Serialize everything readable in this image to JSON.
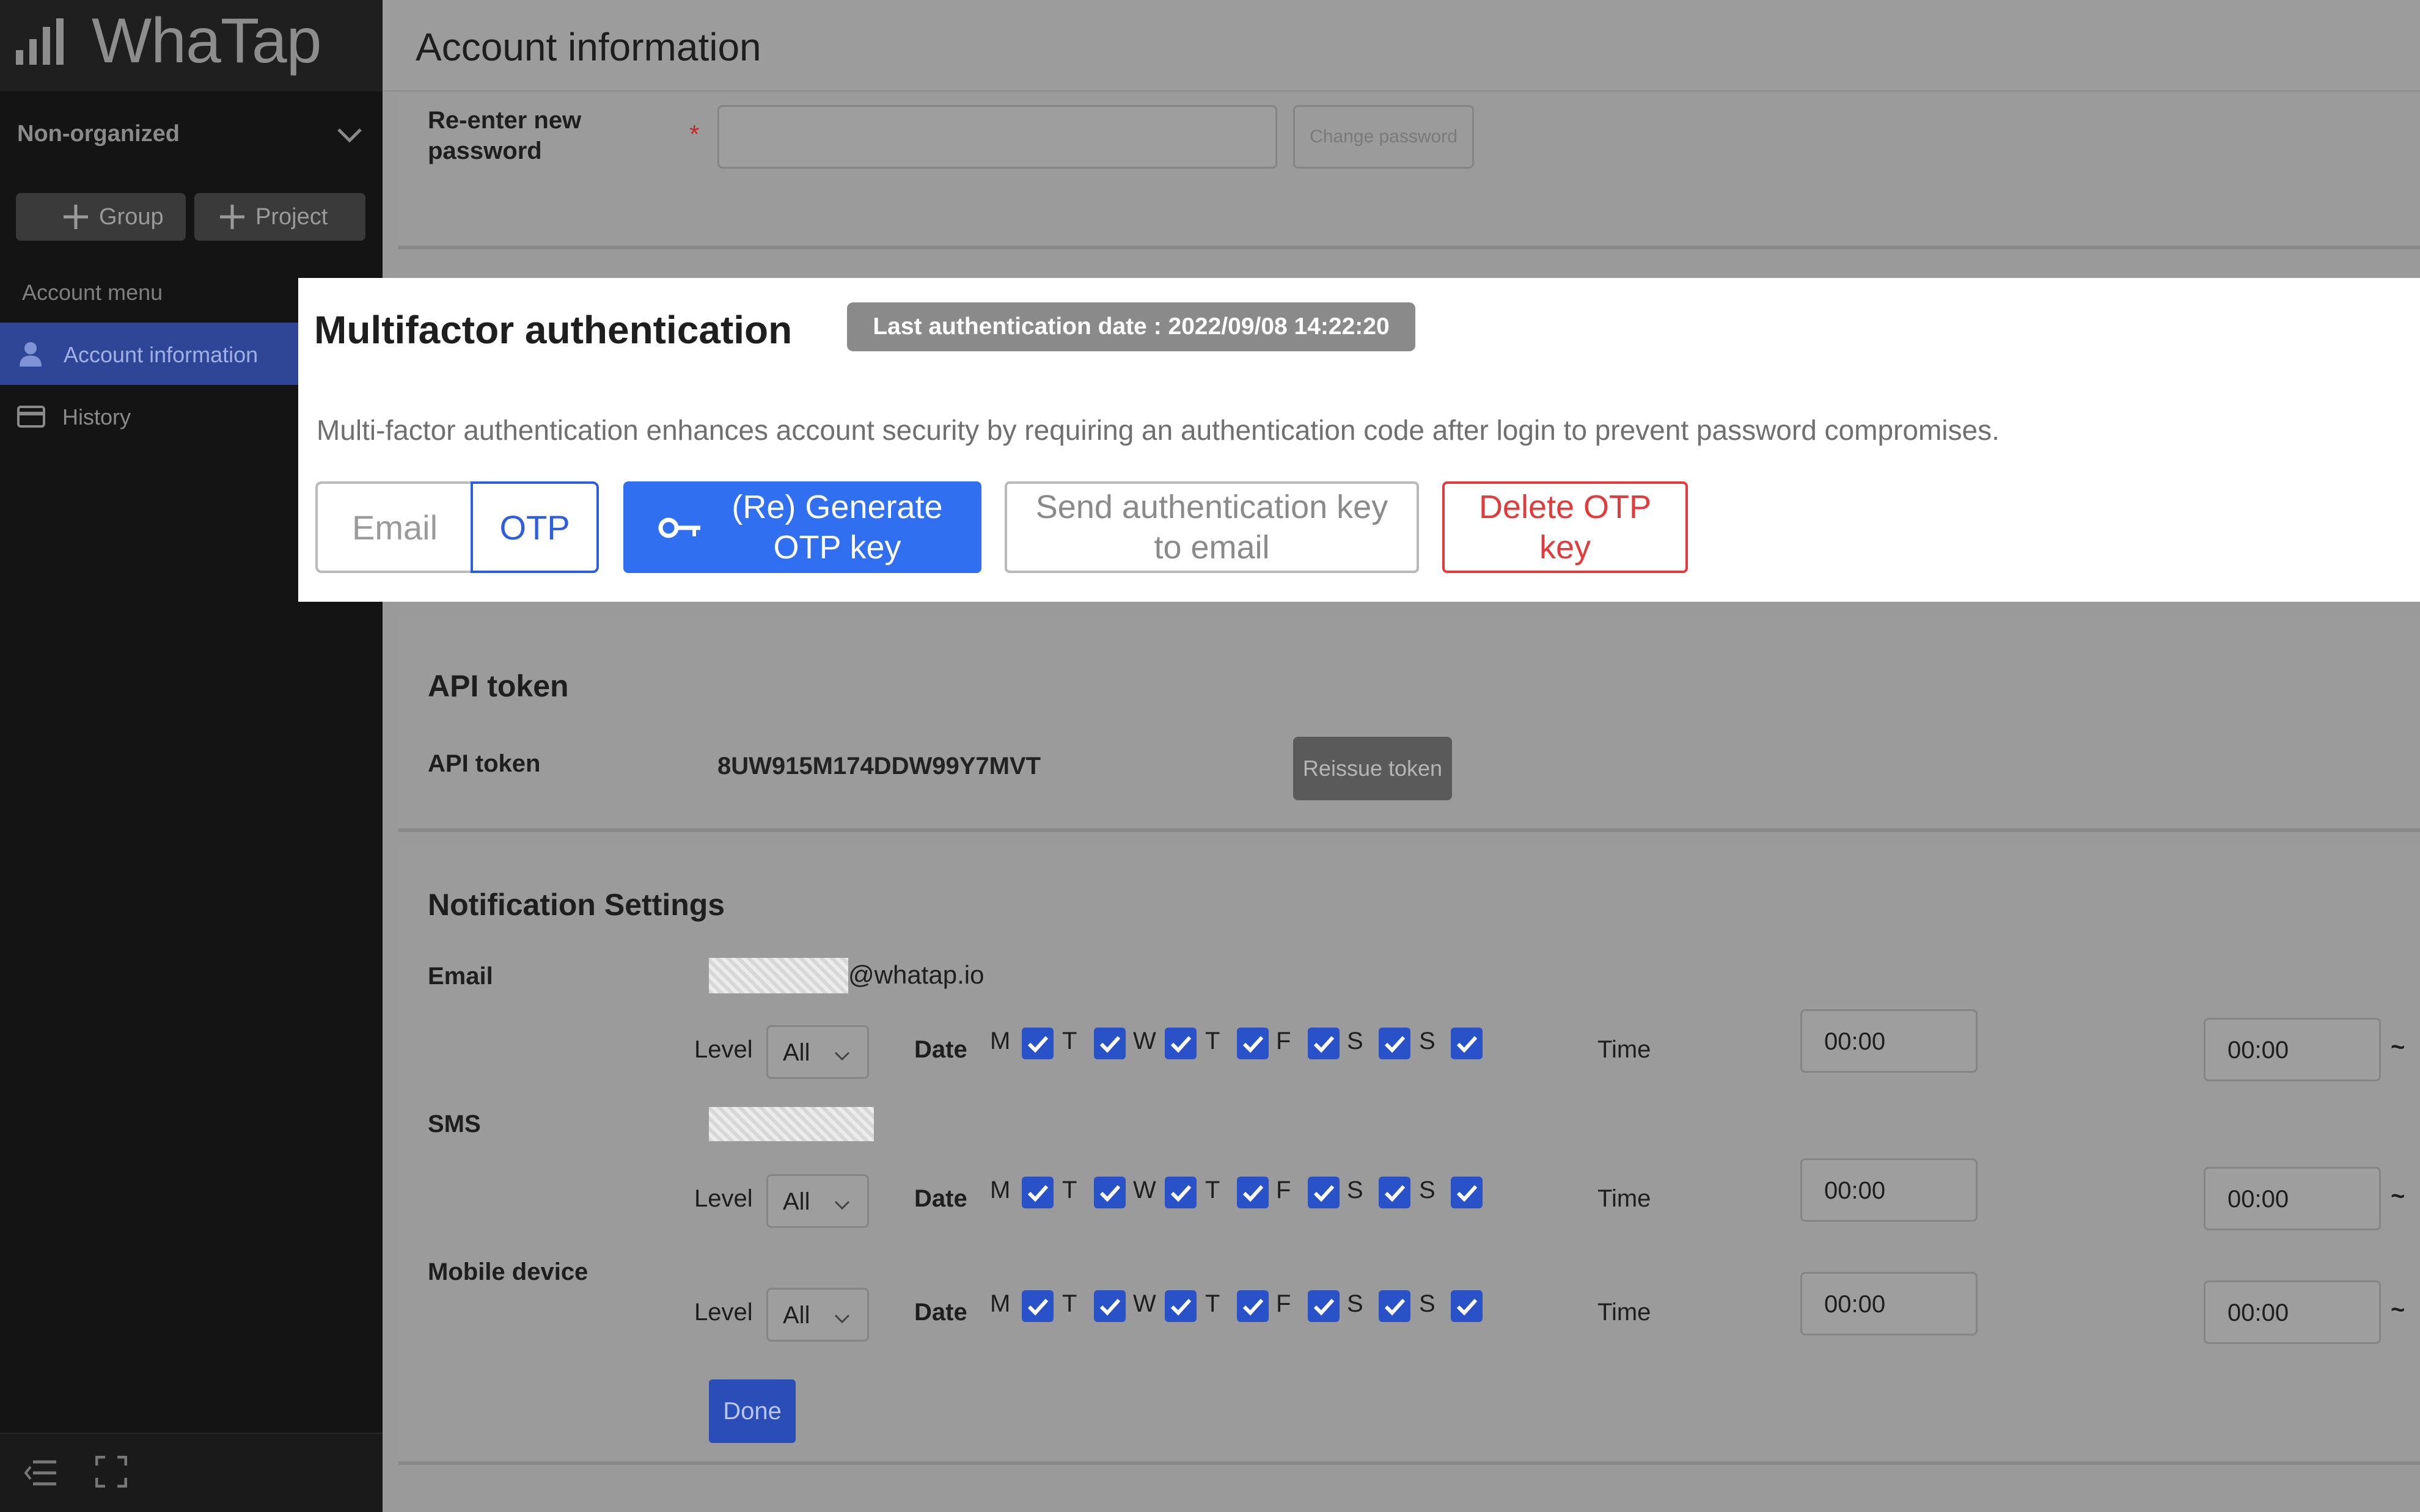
{
  "sidebar": {
    "logo": "WhaTap",
    "org": "Non-organized",
    "add_group": "Group",
    "add_project": "Project",
    "menu_header": "Account menu",
    "items": [
      {
        "label": "Account information"
      },
      {
        "label": "History"
      }
    ]
  },
  "page": {
    "title": "Account information"
  },
  "password": {
    "reenter_label_line1": "Re-enter new",
    "reenter_label_line2": "password",
    "required_mark": "*",
    "change_button": "Change password"
  },
  "mfa": {
    "title": "Multifactor authentication",
    "last_auth": "Last authentication date : 2022/09/08 14:22:20",
    "description": "Multi-factor authentication enhances account security by requiring an authentication code after login to prevent password compromises.",
    "seg_email": "Email",
    "seg_otp": "OTP",
    "generate_line1": "(Re) Generate",
    "generate_line2": "OTP key",
    "send_line1": "Send authentication key",
    "send_line2": "to email",
    "delete_line1": "Delete OTP",
    "delete_line2": "key"
  },
  "api": {
    "section_title": "API token",
    "label": "API token",
    "token": "8UW915M174DDW99Y7MVT",
    "reissue": "Reissue token"
  },
  "notifications": {
    "section_title": "Notification Settings",
    "email_domain": "@whatap.io",
    "level_label": "Level",
    "date_label": "Date",
    "time_label": "Time",
    "tilde": "~",
    "days": [
      "M",
      "T",
      "W",
      "T",
      "F",
      "S",
      "S"
    ],
    "rows": [
      {
        "label": "Email",
        "level": "All",
        "start": "00:00",
        "end": "00:00"
      },
      {
        "label": "SMS",
        "level": "All",
        "start": "00:00",
        "end": "00:00"
      },
      {
        "label": "Mobile device",
        "level": "All",
        "start": "00:00",
        "end": "00:00"
      }
    ],
    "done": "Done"
  },
  "colors": {
    "accent": "#2f6ff0",
    "danger": "#e23b3b",
    "sidebar_active": "#2f4696"
  }
}
